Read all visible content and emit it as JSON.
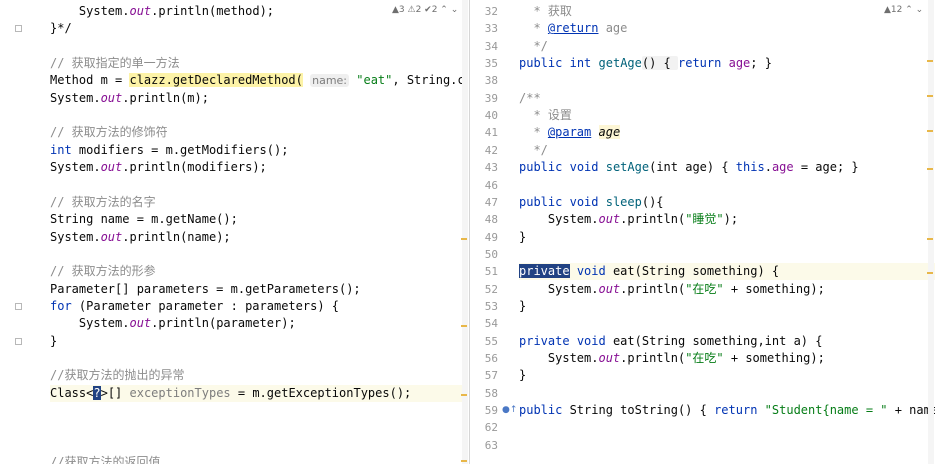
{
  "left": {
    "inspections": "▲3 ⚠2 ✔2 ⌃ ⌄",
    "lines": [
      {
        "type": "println",
        "indent": "    ",
        "arg": "method"
      },
      {
        "type": "plain",
        "text": "}*/"
      },
      {
        "type": "blank"
      },
      {
        "type": "comment",
        "text": "// 获取指定的单一方法"
      },
      {
        "type": "getmethod"
      },
      {
        "type": "println",
        "indent": "",
        "arg": "m"
      },
      {
        "type": "blank"
      },
      {
        "type": "comment",
        "text": "// 获取方法的修饰符"
      },
      {
        "type": "intmod"
      },
      {
        "type": "println",
        "indent": "",
        "arg": "modifiers"
      },
      {
        "type": "blank"
      },
      {
        "type": "comment",
        "text": "// 获取方法的名字"
      },
      {
        "type": "plain",
        "text": "String name = m.getName();"
      },
      {
        "type": "println",
        "indent": "",
        "arg": "name"
      },
      {
        "type": "blank"
      },
      {
        "type": "comment",
        "text": "// 获取方法的形参"
      },
      {
        "type": "plain",
        "text": "Parameter[] parameters = m.getParameters();"
      },
      {
        "type": "forloop"
      },
      {
        "type": "println",
        "indent": "    ",
        "arg": "parameter"
      },
      {
        "type": "plain",
        "text": "}"
      },
      {
        "type": "blank"
      },
      {
        "type": "comment",
        "text": "//获取方法的抛出的异常"
      },
      {
        "type": "exceptions"
      },
      {
        "type": "blank"
      },
      {
        "type": "blank"
      },
      {
        "type": "blank"
      },
      {
        "type": "comment",
        "text": "//获取方法的返回值"
      }
    ],
    "method_call": {
      "receiver": "clazz.getDeclaredMethod(",
      "hint": "name:",
      "arg": "\"eat\"",
      "rest": ", String.class"
    },
    "int_kw": "int",
    "int_rest": " modifiers = m.getModifiers();",
    "for_kw": "for",
    "for_rest": " (Parameter parameter : parameters) {",
    "exc_prefix": "Class<",
    "exc_sel": "?",
    "exc_mid": ">[] ",
    "exc_var": "exceptionTypes",
    "exc_rest": " = m.getExceptionTypes();",
    "println_prefix": "System.",
    "println_out": "out",
    "println_call": ".println("
  },
  "right": {
    "inspections": "▲12 ⌃ ⌄",
    "lines": [
      {
        "num": "32",
        "type": "doc",
        "text": "* 获取"
      },
      {
        "num": "33",
        "type": "doctag",
        "tag": "@return",
        "text": " age"
      },
      {
        "num": "34",
        "type": "doc",
        "text": "*/"
      },
      {
        "num": "35",
        "type": "getage"
      },
      {
        "num": "38",
        "type": "blank"
      },
      {
        "num": "39",
        "type": "doc0",
        "text": "/**"
      },
      {
        "num": "40",
        "type": "doc",
        "text": "* 设置"
      },
      {
        "num": "41",
        "type": "docparam",
        "tag": "@param",
        "param": "age"
      },
      {
        "num": "42",
        "type": "doc",
        "text": "*/"
      },
      {
        "num": "43",
        "type": "setage"
      },
      {
        "num": "46",
        "type": "blank"
      },
      {
        "num": "47",
        "type": "sleep"
      },
      {
        "num": "48",
        "type": "printlnstr",
        "str": "\"睡觉\"",
        "tail": ");"
      },
      {
        "num": "49",
        "type": "close1"
      },
      {
        "num": "50",
        "type": "blank"
      },
      {
        "num": "51",
        "type": "eat1"
      },
      {
        "num": "52",
        "type": "printlnstr",
        "str": "\"在吃\"",
        "tail": " + something);"
      },
      {
        "num": "53",
        "type": "close1"
      },
      {
        "num": "54",
        "type": "blank"
      },
      {
        "num": "55",
        "type": "eat2"
      },
      {
        "num": "56",
        "type": "printlnstr",
        "str": "\"在吃\"",
        "tail": " + something);"
      },
      {
        "num": "57",
        "type": "close1"
      },
      {
        "num": "58",
        "type": "blank"
      },
      {
        "num": "59",
        "type": "tostring"
      },
      {
        "num": "62",
        "type": "close0"
      },
      {
        "num": "63",
        "type": "blank"
      }
    ],
    "kw_public": "public",
    "kw_private": "private",
    "kw_int": "int",
    "kw_void": "void",
    "kw_return": "return",
    "kw_this": "this",
    "getage_name": "getAge",
    "getage_body": "() { ",
    "getage_field": "age",
    "getage_end": "; }",
    "setage_name": "setAge",
    "setage_sig": "(int age) { ",
    "setage_this": "this",
    "setage_dot": ".",
    "setage_field": "age",
    "setage_end": " = age; }",
    "sleep_name": "sleep",
    "sleep_sig": "(){",
    "eat_name": "eat",
    "eat1_sig": "(String something) {",
    "eat2_sig": "(String something,int a) {",
    "tostring_sig": " String toString() { ",
    "tostring_str": "\"Student{name = \"",
    "tostring_tail": " + name"
  }
}
